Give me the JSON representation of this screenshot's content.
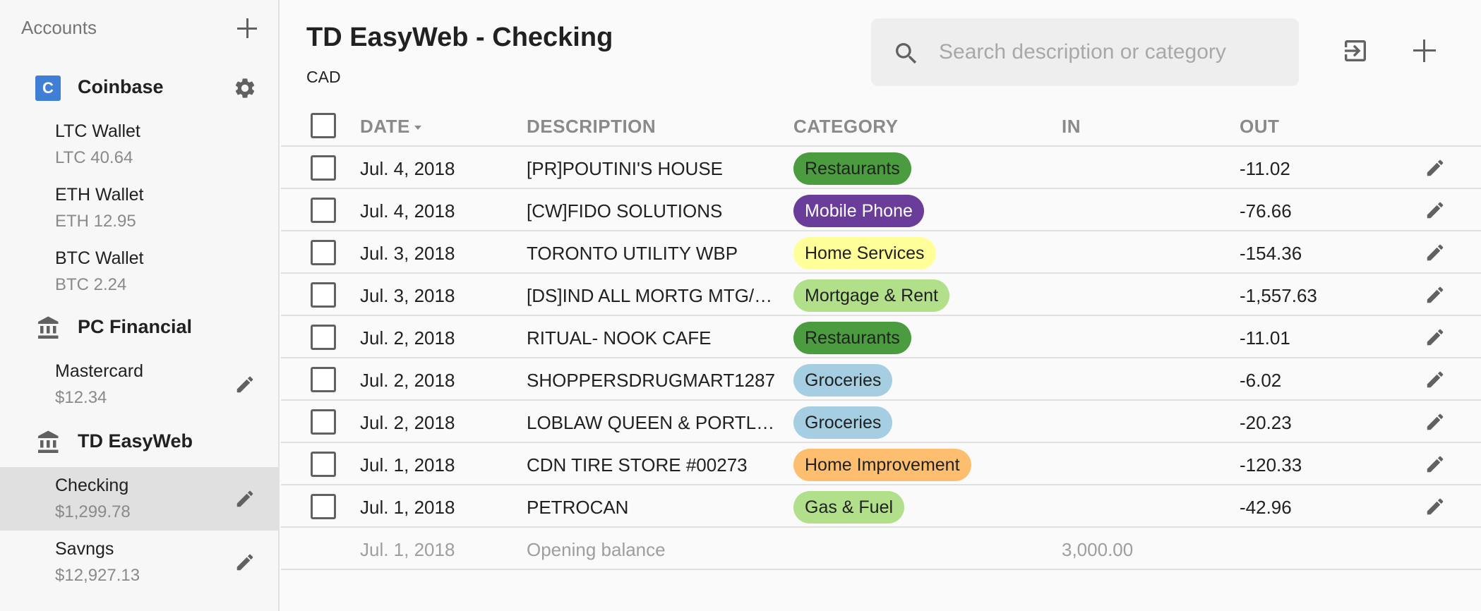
{
  "sidebar": {
    "title": "Accounts",
    "providers": [
      {
        "name": "Coinbase",
        "logo_letter": "C",
        "icon": "coinbase-logo",
        "accounts": [
          {
            "name": "LTC Wallet",
            "balance": "LTC 40.64"
          },
          {
            "name": "ETH Wallet",
            "balance": "ETH 12.95"
          },
          {
            "name": "BTC Wallet",
            "balance": "BTC 2.24"
          }
        ]
      },
      {
        "name": "PC Financial",
        "icon": "bank-icon",
        "accounts": [
          {
            "name": "Mastercard",
            "balance": "$12.34"
          }
        ]
      },
      {
        "name": "TD EasyWeb",
        "icon": "bank-icon",
        "accounts": [
          {
            "name": "Checking",
            "balance": "$1,299.78",
            "selected": true
          },
          {
            "name": "Savngs",
            "balance": "$12,927.13"
          }
        ]
      }
    ]
  },
  "header": {
    "title": "TD EasyWeb - Checking",
    "currency": "CAD",
    "search_placeholder": "Search description or category"
  },
  "table": {
    "columns": {
      "date": "DATE",
      "description": "DESCRIPTION",
      "category": "CATEGORY",
      "in": "IN",
      "out": "OUT"
    },
    "rows": [
      {
        "date": "Jul. 4, 2018",
        "description": "[PR]POUTINI'S HOUSE",
        "category": "Restaurants",
        "in": "",
        "out": "-11.02"
      },
      {
        "date": "Jul. 4, 2018",
        "description": "[CW]FIDO SOLUTIONS",
        "category": "Mobile Phone",
        "in": "",
        "out": "-76.66"
      },
      {
        "date": "Jul. 3, 2018",
        "description": "TORONTO UTILITY WBP",
        "category": "Home Services",
        "in": "",
        "out": "-154.36"
      },
      {
        "date": "Jul. 3, 2018",
        "description": "[DS]IND ALL MORTG MTG/…",
        "category": "Mortgage & Rent",
        "in": "",
        "out": "-1,557.63"
      },
      {
        "date": "Jul. 2, 2018",
        "description": "RITUAL- NOOK CAFE",
        "category": "Restaurants",
        "in": "",
        "out": "-11.01"
      },
      {
        "date": "Jul. 2, 2018",
        "description": "SHOPPERSDRUGMART1287",
        "category": "Groceries",
        "in": "",
        "out": "-6.02"
      },
      {
        "date": "Jul. 2, 2018",
        "description": "LOBLAW QUEEN & PORTL…",
        "category": "Groceries",
        "in": "",
        "out": "-20.23"
      },
      {
        "date": "Jul. 1, 2018",
        "description": "CDN TIRE STORE #00273",
        "category": "Home Improvement",
        "in": "",
        "out": "-120.33"
      },
      {
        "date": "Jul. 1, 2018",
        "description": "PETROCAN",
        "category": "Gas & Fuel",
        "in": "",
        "out": "-42.96"
      }
    ],
    "opening": {
      "date": "Jul. 1, 2018",
      "description": "Opening balance",
      "in": "3,000.00",
      "out": ""
    }
  },
  "category_colors": {
    "Restaurants": "#4a9c3f",
    "Mobile Phone": "#6a3d9a",
    "Home Services": "#ffff99",
    "Mortgage & Rent": "#b2df8a",
    "Groceries": "#a6cee3",
    "Home Improvement": "#fdbf6f",
    "Gas & Fuel": "#b2df8a"
  },
  "category_text_colors": {
    "Mobile Phone": "#ffffff"
  }
}
